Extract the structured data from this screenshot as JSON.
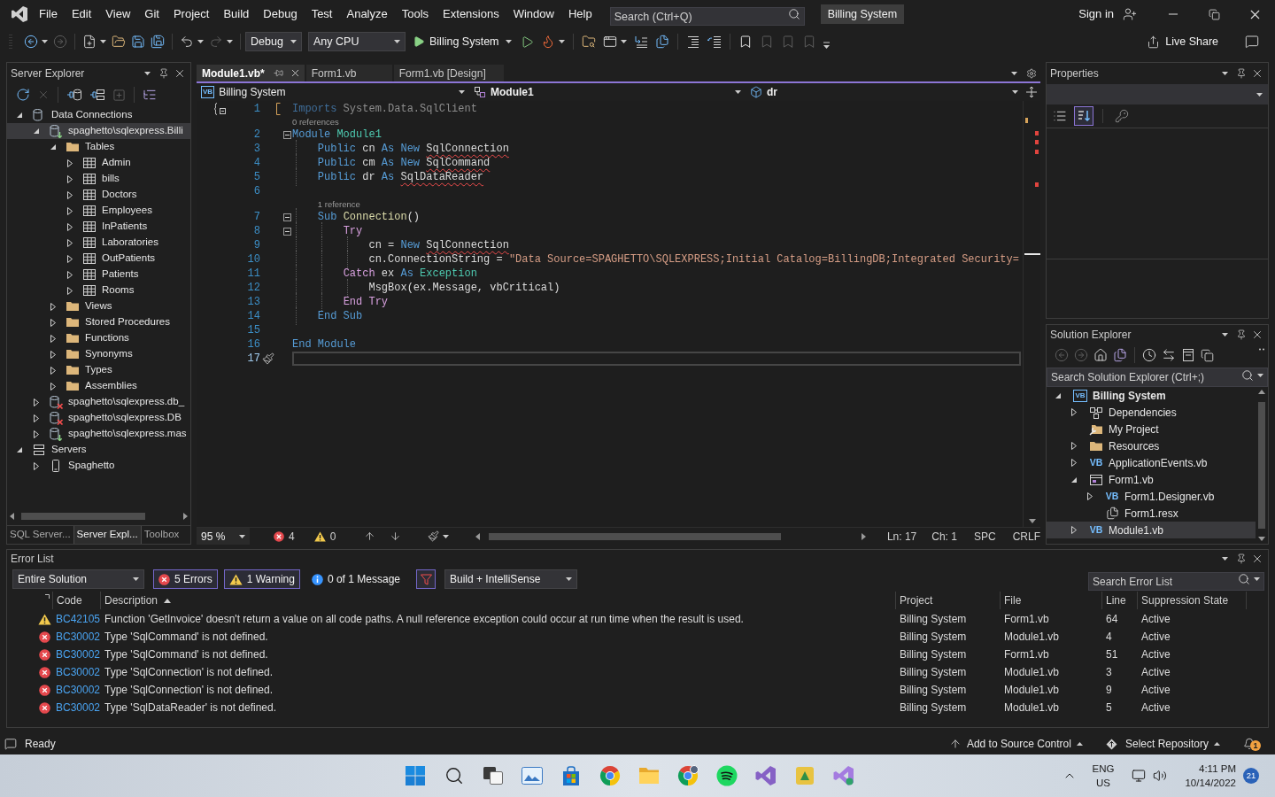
{
  "title_bar": {
    "menus": [
      "File",
      "Edit",
      "View",
      "Git",
      "Project",
      "Build",
      "Debug",
      "Test",
      "Analyze",
      "Tools",
      "Extensions",
      "Window",
      "Help"
    ],
    "search": {
      "placeholder": "Search (Ctrl+Q)"
    },
    "solution_name": "Billing System",
    "sign_in": "Sign in"
  },
  "toolbar": {
    "groups": [
      [
        {
          "kind": "back",
          "menu": true,
          "disabled": false
        },
        {
          "kind": "forward",
          "menu": false,
          "disabled": true
        }
      ],
      [
        {
          "kind": "new_item",
          "menu": true,
          "disabled": false
        },
        {
          "kind": "open",
          "menu": false,
          "disabled": false
        },
        {
          "kind": "save",
          "menu": false,
          "disabled": false
        },
        {
          "kind": "save_all",
          "menu": false,
          "disabled": false
        }
      ],
      [
        {
          "kind": "undo",
          "menu": true,
          "disabled": false
        },
        {
          "kind": "redo",
          "menu": true,
          "disabled": true
        }
      ]
    ],
    "configuration": "Debug",
    "platform": "Any CPU",
    "start_target": "Billing System",
    "after_groups": [
      [
        {
          "kind": "run_outline",
          "menu": false,
          "disabled": false
        },
        {
          "kind": "hot_reload",
          "menu": true,
          "disabled": false
        }
      ],
      [
        {
          "kind": "folder_search",
          "menu": false,
          "disabled": false
        },
        {
          "kind": "window",
          "menu": true,
          "disabled": false
        },
        {
          "kind": "insert_lines",
          "menu": false,
          "disabled": false
        },
        {
          "kind": "file_list",
          "menu": false,
          "disabled": false
        }
      ],
      [
        {
          "kind": "indent",
          "menu": false,
          "disabled": false
        },
        {
          "kind": "outdent",
          "menu": false,
          "disabled": false
        }
      ],
      [
        {
          "kind": "bookmark",
          "menu": false,
          "disabled": false
        },
        {
          "kind": "bookmark_prev",
          "menu": false,
          "disabled": true
        },
        {
          "kind": "bookmark_next",
          "menu": false,
          "disabled": true
        },
        {
          "kind": "bookmark_clear",
          "menu": false,
          "disabled": true
        }
      ]
    ],
    "live_share": "Live Share"
  },
  "server_explorer": {
    "title": "Server Explorer",
    "tools": [
      [
        {
          "kind": "refresh",
          "disabled": false
        },
        {
          "kind": "stop",
          "disabled": true
        }
      ],
      [
        {
          "kind": "connect_database",
          "disabled": false
        },
        {
          "kind": "connect_server",
          "disabled": false
        },
        {
          "kind": "add",
          "disabled": true
        }
      ],
      [
        {
          "kind": "properties",
          "disabled": false
        }
      ]
    ],
    "tree": [
      {
        "label": "Data Connections",
        "kind": "connections",
        "expanded": true,
        "selected": false,
        "children": [
          {
            "label": "spaghetto\\sqlexpress.Billi",
            "kind": "connection",
            "expanded": true,
            "selected": true,
            "children": [
              {
                "label": "Tables",
                "kind": "folder",
                "expanded": true,
                "selected": false,
                "children": [
                  {
                    "label": "Admin",
                    "kind": "table",
                    "expanded": false,
                    "selected": false
                  },
                  {
                    "label": "bills",
                    "kind": "table",
                    "expanded": false,
                    "selected": false
                  },
                  {
                    "label": "Doctors",
                    "kind": "table",
                    "expanded": false,
                    "selected": false
                  },
                  {
                    "label": "Employees",
                    "kind": "table",
                    "expanded": false,
                    "selected": false
                  },
                  {
                    "label": "InPatients",
                    "kind": "table",
                    "expanded": false,
                    "selected": false
                  },
                  {
                    "label": "Laboratories",
                    "kind": "table",
                    "expanded": false,
                    "selected": false
                  },
                  {
                    "label": "OutPatients",
                    "kind": "table",
                    "expanded": false,
                    "selected": false
                  },
                  {
                    "label": "Patients",
                    "kind": "table",
                    "expanded": false,
                    "selected": false
                  },
                  {
                    "label": "Rooms",
                    "kind": "table",
                    "expanded": false,
                    "selected": false
                  }
                ]
              },
              {
                "label": "Views",
                "kind": "folder",
                "expanded": false,
                "selected": false
              },
              {
                "label": "Stored Procedures",
                "kind": "folder",
                "expanded": false,
                "selected": false
              },
              {
                "label": "Functions",
                "kind": "folder",
                "expanded": false,
                "selected": false
              },
              {
                "label": "Synonyms",
                "kind": "folder",
                "expanded": false,
                "selected": false
              },
              {
                "label": "Types",
                "kind": "folder",
                "expanded": false,
                "selected": false
              },
              {
                "label": "Assemblies",
                "kind": "folder",
                "expanded": false,
                "selected": false
              }
            ]
          },
          {
            "label": "spaghetto\\sqlexpress.db_",
            "kind": "connection_broken",
            "expanded": false,
            "selected": false
          },
          {
            "label": "spaghetto\\sqlexpress.DB",
            "kind": "connection_broken",
            "expanded": false,
            "selected": false
          },
          {
            "label": "spaghetto\\sqlexpress.mas",
            "kind": "connection",
            "expanded": false,
            "selected": false
          }
        ]
      },
      {
        "label": "Servers",
        "kind": "servers",
        "expanded": true,
        "selected": false,
        "children": [
          {
            "label": "Spaghetto",
            "kind": "server",
            "expanded": false,
            "selected": false
          }
        ]
      }
    ],
    "tabs": [
      {
        "label": "SQL Server...",
        "selected": false
      },
      {
        "label": "Server Expl...",
        "selected": true
      },
      {
        "label": "Toolbox",
        "selected": false
      }
    ]
  },
  "editor": {
    "tabs": [
      {
        "label": "Module1.vb*",
        "selected": true
      },
      {
        "label": "Form1.vb",
        "selected": false
      },
      {
        "label": "Form1.vb [Design]",
        "selected": false
      }
    ],
    "navigation": {
      "project_icon": "VB",
      "project": "Billing System",
      "type": "Module1",
      "member": "dr"
    },
    "lines": [
      {
        "number": "1",
        "changed": true,
        "fold": false,
        "current": false,
        "glyph": {
          "kind": "braces"
        },
        "tokens": [
          {
            "text": "Imports",
            "kind": "keyword_faded"
          },
          {
            "text": " System.Data.SqlClient",
            "kind": "faded"
          }
        ]
      },
      {
        "number": "2",
        "codelens": "0 references",
        "changed": false,
        "fold": true,
        "current": false,
        "tokens": [
          {
            "text": "Module",
            "kind": "keyword"
          },
          {
            "text": " Module1",
            "kind": "type"
          }
        ]
      },
      {
        "number": "3",
        "changed": false,
        "fold": false,
        "current": false,
        "tokens": [
          {
            "text": "    Public",
            "kind": "keyword"
          },
          {
            "text": " cn ",
            "kind": "plain"
          },
          {
            "text": "As New ",
            "kind": "keyword"
          },
          {
            "text": "SqlConnection",
            "kind": "unresolved"
          }
        ]
      },
      {
        "number": "4",
        "changed": false,
        "fold": false,
        "current": false,
        "tokens": [
          {
            "text": "    Public",
            "kind": "keyword"
          },
          {
            "text": " cm ",
            "kind": "plain"
          },
          {
            "text": "As New ",
            "kind": "keyword"
          },
          {
            "text": "SqlCommand",
            "kind": "unresolved"
          }
        ]
      },
      {
        "number": "5",
        "changed": false,
        "fold": false,
        "current": false,
        "tokens": [
          {
            "text": "    Public",
            "kind": "keyword"
          },
          {
            "text": " dr ",
            "kind": "plain"
          },
          {
            "text": "As ",
            "kind": "keyword"
          },
          {
            "text": "SqlDataReader",
            "kind": "unresolved"
          }
        ]
      },
      {
        "number": "6",
        "changed": false,
        "fold": false,
        "current": false
      },
      {
        "number": "7",
        "codelens": "1 reference",
        "changed": false,
        "fold": true,
        "current": false,
        "tokens": [
          {
            "text": "    Sub ",
            "kind": "keyword"
          },
          {
            "text": "Connection",
            "kind": "method"
          },
          {
            "text": "()",
            "kind": "plain"
          }
        ]
      },
      {
        "number": "8",
        "changed": false,
        "fold": true,
        "current": false,
        "tokens": [
          {
            "text": "        Try",
            "kind": "control"
          }
        ]
      },
      {
        "number": "9",
        "changed": false,
        "fold": false,
        "current": false,
        "tokens": [
          {
            "text": "            cn = ",
            "kind": "plain"
          },
          {
            "text": "New ",
            "kind": "keyword"
          },
          {
            "text": "SqlConnection",
            "kind": "unresolved"
          }
        ]
      },
      {
        "number": "10",
        "changed": false,
        "fold": false,
        "current": false,
        "tokens": [
          {
            "text": "            cn.ConnectionString = ",
            "kind": "plain"
          },
          {
            "text": "\"Data Source=SPAGHETTO\\SQLEXPRESS;Initial Catalog=BillingDB;Integrated Security=",
            "kind": "string"
          }
        ]
      },
      {
        "number": "11",
        "changed": false,
        "fold": false,
        "current": false,
        "tokens": [
          {
            "text": "        Catch",
            "kind": "control"
          },
          {
            "text": " ex ",
            "kind": "plain"
          },
          {
            "text": "As ",
            "kind": "keyword"
          },
          {
            "text": "Exception",
            "kind": "type"
          }
        ]
      },
      {
        "number": "12",
        "changed": false,
        "fold": false,
        "current": false,
        "tokens": [
          {
            "text": "            MsgBox(ex.Message, vbCritical)",
            "kind": "plain"
          }
        ]
      },
      {
        "number": "13",
        "changed": false,
        "fold": false,
        "current": false,
        "tokens": [
          {
            "text": "        End Try",
            "kind": "control"
          }
        ]
      },
      {
        "number": "14",
        "changed": false,
        "fold": false,
        "current": false,
        "tokens": [
          {
            "text": "    End Sub",
            "kind": "keyword"
          }
        ]
      },
      {
        "number": "15",
        "changed": false,
        "fold": false,
        "current": false
      },
      {
        "number": "16",
        "changed": false,
        "fold": false,
        "current": false,
        "tokens": [
          {
            "text": "End Module",
            "kind": "keyword"
          }
        ]
      },
      {
        "number": "17",
        "changed": false,
        "fold": false,
        "current": true,
        "glyph": {
          "kind": "brush"
        }
      }
    ],
    "status": {
      "zoom": "95 %",
      "errors": "4",
      "warnings": "0",
      "line": "Ln: 17",
      "column": "Ch: 1",
      "whitespace": "SPC",
      "line_ending": "CRLF"
    }
  },
  "properties": {
    "title": "Properties",
    "view_buttons": [
      {
        "kind": "categorized",
        "selected": false
      },
      {
        "kind": "alphabetical",
        "selected": true
      },
      {
        "kind": "property_pages",
        "selected": false
      }
    ]
  },
  "solution_explorer": {
    "title": "Solution Explorer",
    "tools": [
      [
        {
          "kind": "back",
          "disabled": true
        },
        {
          "kind": "forward",
          "disabled": true
        },
        {
          "kind": "home",
          "disabled": false
        },
        {
          "kind": "switch_views",
          "disabled": false
        }
      ],
      [
        {
          "kind": "pending_filter",
          "disabled": false
        },
        {
          "kind": "sync",
          "disabled": false
        },
        {
          "kind": "collapse_all",
          "disabled": false
        },
        {
          "kind": "show_all",
          "disabled": false
        }
      ]
    ],
    "search": {
      "placeholder": "Search Solution Explorer (Ctrl+;)"
    },
    "tree": [
      {
        "label": "Billing System",
        "kind": "project",
        "icon_text": "VB",
        "expanded": true,
        "selected": false,
        "children": [
          {
            "label": "Dependencies",
            "kind": "dependencies",
            "expanded": false,
            "selected": false
          },
          {
            "label": "My Project",
            "kind": "my_project",
            "selected": false
          },
          {
            "label": "Resources",
            "kind": "folder",
            "expanded": false,
            "selected": false
          },
          {
            "label": "ApplicationEvents.vb",
            "kind": "vb_file",
            "icon_text": "VB",
            "expanded": false,
            "selected": false
          },
          {
            "label": "Form1.vb",
            "kind": "form",
            "expanded": true,
            "selected": false,
            "children": [
              {
                "label": "Form1.Designer.vb",
                "kind": "vb_file",
                "icon_text": "VB",
                "expanded": false,
                "selected": false
              },
              {
                "label": "Form1.resx",
                "kind": "resource",
                "selected": false
              }
            ]
          },
          {
            "label": "Module1.vb",
            "kind": "vb_file",
            "icon_text": "VB",
            "expanded": false,
            "selected": true
          }
        ]
      }
    ]
  },
  "error_list": {
    "title": "Error List",
    "scope": "Entire Solution",
    "filters": [
      {
        "kind": "errors",
        "label": "5 Errors",
        "on": true
      },
      {
        "kind": "warnings",
        "label": "1 Warning",
        "on": true
      },
      {
        "kind": "messages",
        "label": "0 of 1 Message",
        "on": false
      }
    ],
    "filter_toggle": {
      "on": true
    },
    "source": "Build + IntelliSense",
    "search": {
      "placeholder": "Search Error List"
    },
    "columns": [
      {
        "label": "Code",
        "sorted": false
      },
      {
        "label": "Description",
        "sorted": true
      },
      {
        "label": "Project",
        "sorted": false
      },
      {
        "label": "File",
        "sorted": false
      },
      {
        "label": "Line",
        "sorted": false
      },
      {
        "label": "Suppression State",
        "sorted": false
      }
    ],
    "rows": [
      {
        "kind": "warning",
        "code": "BC42105",
        "description": "Function 'GetInvoice' doesn't return a value on all code paths. A null reference exception could occur at run time when the result is used.",
        "project": "Billing System",
        "file": "Form1.vb",
        "line": "64",
        "suppression_state": "Active"
      },
      {
        "kind": "error",
        "code": "BC30002",
        "description": "Type 'SqlCommand' is not defined.",
        "project": "Billing System",
        "file": "Module1.vb",
        "line": "4",
        "suppression_state": "Active"
      },
      {
        "kind": "error",
        "code": "BC30002",
        "description": "Type 'SqlCommand' is not defined.",
        "project": "Billing System",
        "file": "Form1.vb",
        "line": "51",
        "suppression_state": "Active"
      },
      {
        "kind": "error",
        "code": "BC30002",
        "description": "Type 'SqlConnection' is not defined.",
        "project": "Billing System",
        "file": "Module1.vb",
        "line": "3",
        "suppression_state": "Active"
      },
      {
        "kind": "error",
        "code": "BC30002",
        "description": "Type 'SqlConnection' is not defined.",
        "project": "Billing System",
        "file": "Module1.vb",
        "line": "9",
        "suppression_state": "Active"
      },
      {
        "kind": "error",
        "code": "BC30002",
        "description": "Type 'SqlDataReader' is not defined.",
        "project": "Billing System",
        "file": "Module1.vb",
        "line": "5",
        "suppression_state": "Active"
      }
    ]
  },
  "status_bar": {
    "message": "Ready",
    "source_control": "Add to Source Control",
    "repository": "Select Repository",
    "notifications": "1"
  },
  "taskbar": {
    "apps": [
      {
        "kind": "start"
      },
      {
        "kind": "search"
      },
      {
        "kind": "task_view"
      },
      {
        "kind": "gallery"
      },
      {
        "kind": "store"
      },
      {
        "kind": "browser"
      },
      {
        "kind": "files"
      },
      {
        "kind": "browser_alt"
      },
      {
        "kind": "music"
      },
      {
        "kind": "ide"
      },
      {
        "kind": "tool"
      },
      {
        "kind": "ide_alt"
      }
    ],
    "language": "ENG",
    "region": "US",
    "time": "4:11 PM",
    "date": "10/14/2022",
    "notifications": "21"
  }
}
